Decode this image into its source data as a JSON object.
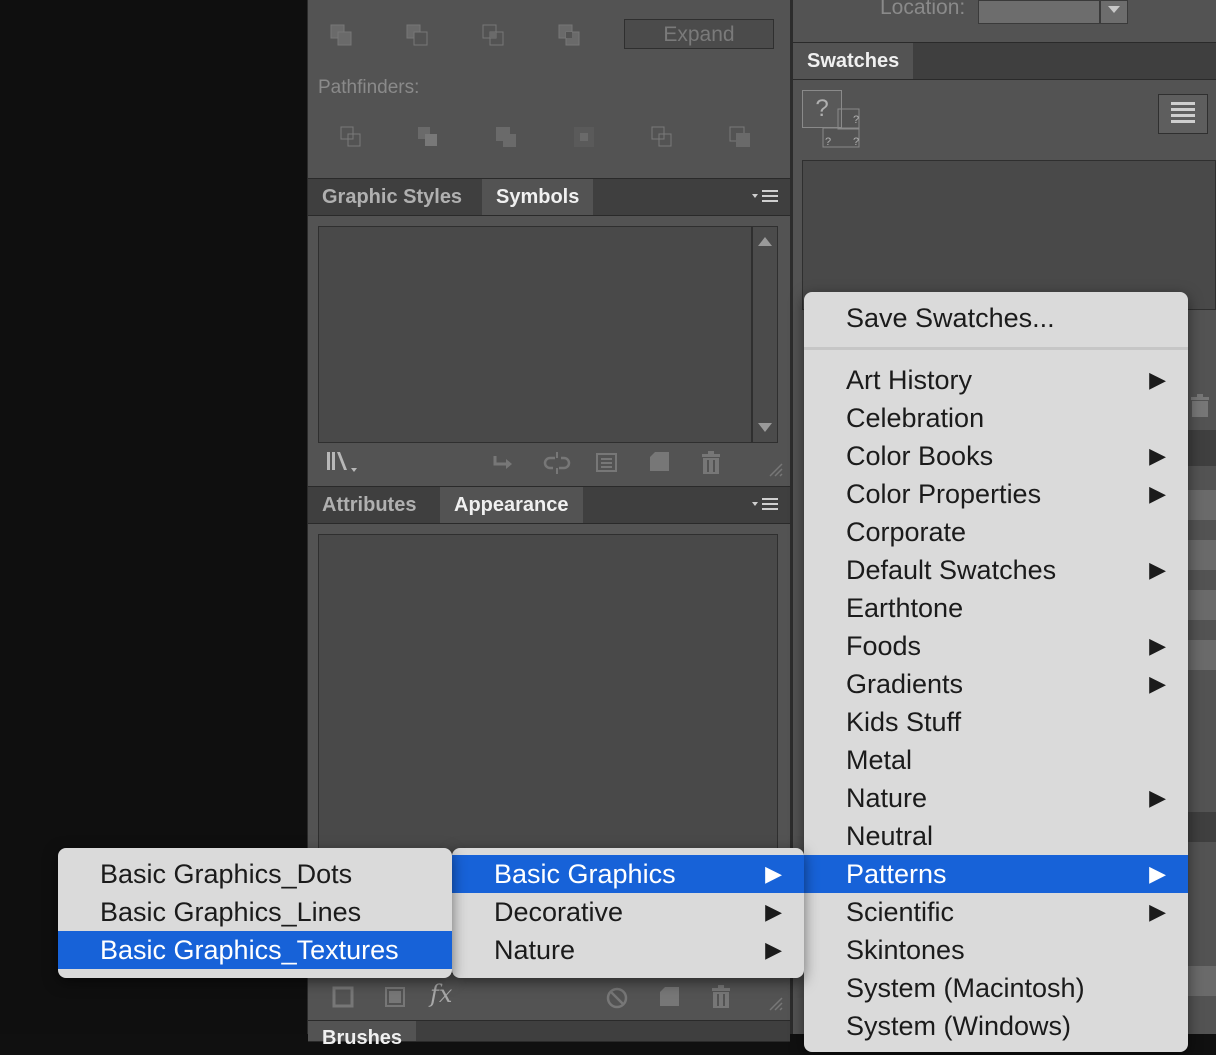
{
  "pathfinder": {
    "expand_label": "Expand",
    "pathfinders_label": "Pathfinders:"
  },
  "location": {
    "label": "Location:"
  },
  "symbols_panel": {
    "tabs": [
      "Graphic Styles",
      "Symbols"
    ],
    "active_tab": 1
  },
  "appearance_panel": {
    "tabs": [
      "Attributes",
      "Appearance"
    ],
    "active_tab": 1
  },
  "swatches": {
    "tab": "Swatches",
    "unknown_glyph": "?"
  },
  "brushes": {
    "tab": "Brushes"
  },
  "swatch_menu": {
    "save_label": "Save Swatches...",
    "items": [
      {
        "label": "Art History",
        "submenu": true
      },
      {
        "label": "Celebration",
        "submenu": false
      },
      {
        "label": "Color Books",
        "submenu": true
      },
      {
        "label": "Color Properties",
        "submenu": true
      },
      {
        "label": "Corporate",
        "submenu": false
      },
      {
        "label": "Default Swatches",
        "submenu": true
      },
      {
        "label": "Earthtone",
        "submenu": false
      },
      {
        "label": "Foods",
        "submenu": true
      },
      {
        "label": "Gradients",
        "submenu": true
      },
      {
        "label": "Kids Stuff",
        "submenu": false
      },
      {
        "label": "Metal",
        "submenu": false
      },
      {
        "label": "Nature",
        "submenu": true
      },
      {
        "label": "Neutral",
        "submenu": false
      },
      {
        "label": "Patterns",
        "submenu": true,
        "selected": true
      },
      {
        "label": "Scientific",
        "submenu": true
      },
      {
        "label": "Skintones",
        "submenu": false
      },
      {
        "label": "System (Macintosh)",
        "submenu": false
      },
      {
        "label": "System (Windows)",
        "submenu": false
      }
    ]
  },
  "patterns_menu": {
    "items": [
      {
        "label": "Basic Graphics",
        "submenu": true,
        "selected": true
      },
      {
        "label": "Decorative",
        "submenu": true
      },
      {
        "label": "Nature",
        "submenu": true
      }
    ]
  },
  "basic_graphics_menu": {
    "items": [
      {
        "label": "Basic Graphics_Dots"
      },
      {
        "label": "Basic Graphics_Lines"
      },
      {
        "label": "Basic Graphics_Textures",
        "selected": true
      }
    ]
  },
  "colors": {
    "menu_bg": "#dadada",
    "selection": "#1762d8",
    "panel_bg": "#535353",
    "tab_bar_bg": "#3f3f3f"
  },
  "glyphs": {
    "arrow": "▶",
    "fx": "fx"
  }
}
